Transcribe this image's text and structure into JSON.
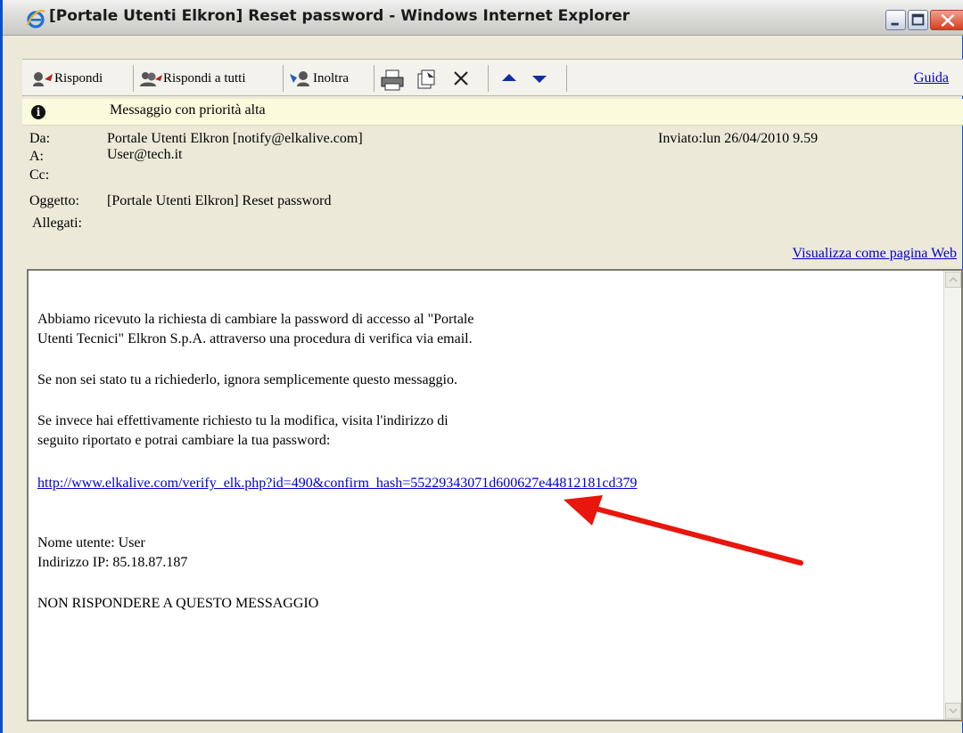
{
  "window": {
    "title": "[Portale Utenti Elkron] Reset password - Windows Internet Explorer"
  },
  "toolbar": {
    "reply_label": "Rispondi",
    "reply_all_label": "Rispondi a tutti",
    "forward_label": "Inoltra",
    "help_label": "Guida"
  },
  "priority": {
    "text": "Messaggio con priorità alta"
  },
  "header": {
    "from_label": "Da:",
    "from_value": "Portale Utenti Elkron [notify@elkalive.com]",
    "to_label": "A:",
    "to_value": "User@tech.it",
    "cc_label": "Cc:",
    "subject_label": "Oggetto:",
    "subject_value": "[Portale Utenti Elkron] Reset password",
    "attachments_label": "Allegati:",
    "sent": "Inviato:lun 26/04/2010 9.59",
    "view_web": "Visualizza come pagina Web"
  },
  "message": {
    "p1_line1": "Abbiamo ricevuto la richiesta di cambiare la password di accesso al \"Portale",
    "p1_line2": "Utenti Tecnici\" Elkron S.p.A. attraverso una procedura di verifica via email.",
    "p2": "Se non sei stato tu a richiederlo, ignora semplicemente questo messaggio.",
    "p3_line1": "Se invece hai effettivamente richiesto tu la modifica, visita l'indirizzo di",
    "p3_line2": "seguito riportato e potrai cambiare la tua password:",
    "link": "http://www.elkalive.com/verify_elk.php?id=490&confirm_hash=55229343071d600627e44812181cd379",
    "username_line": "Nome utente:  User",
    "ip_line": "Indirizzo IP: 85.18.87.187",
    "no_reply": "NON RISPONDERE A QUESTO MESSAGGIO"
  },
  "annotation": {
    "arrow_color": "#e8160c"
  },
  "colors": {
    "link": "#0000cc",
    "priority_bg": "#fafadc",
    "chrome_bg": "#ece9d8"
  }
}
